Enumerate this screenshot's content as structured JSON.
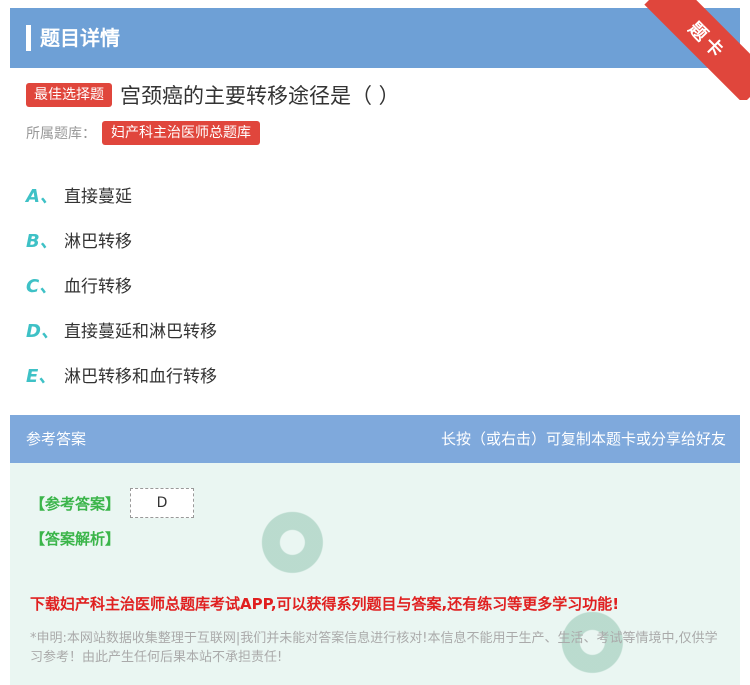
{
  "header": {
    "title": "题目详情",
    "corner_ribbon": "题卡"
  },
  "question": {
    "type_badge": "最佳选择题",
    "text": "宫颈癌的主要转移途径是（ ）",
    "bank_label": "所属题库：",
    "bank_name": "妇产科主治医师总题库"
  },
  "options": [
    {
      "letter": "A、",
      "text": "直接蔓延"
    },
    {
      "letter": "B、",
      "text": "淋巴转移"
    },
    {
      "letter": "C、",
      "text": "血行转移"
    },
    {
      "letter": "D、",
      "text": "直接蔓延和淋巴转移"
    },
    {
      "letter": "E、",
      "text": "淋巴转移和血行转移"
    }
  ],
  "answer_section": {
    "title": "参考答案",
    "hint": "长按（或右击）可复制本题卡或分享给好友",
    "ref_answer_label": "【参考答案】",
    "ref_answer_value": "D",
    "explanation_label": "【答案解析】",
    "promo": "下载妇产科主治医师总题库考试APP,可以获得系列题目与答案,还有练习等更多学习功能!",
    "disclaimer": "*申明:本网站数据收集整理于互联网|我们并未能对答案信息进行核对!本信息不能用于生产、生活、考试等情境中,仅供学习参考！由此产生任何后果本站不承担责任!"
  },
  "colors": {
    "header_blue": "#6ea0d6",
    "accent_red": "#e0463c",
    "option_teal": "#3ec1c6",
    "answer_green": "#3bb54a"
  }
}
